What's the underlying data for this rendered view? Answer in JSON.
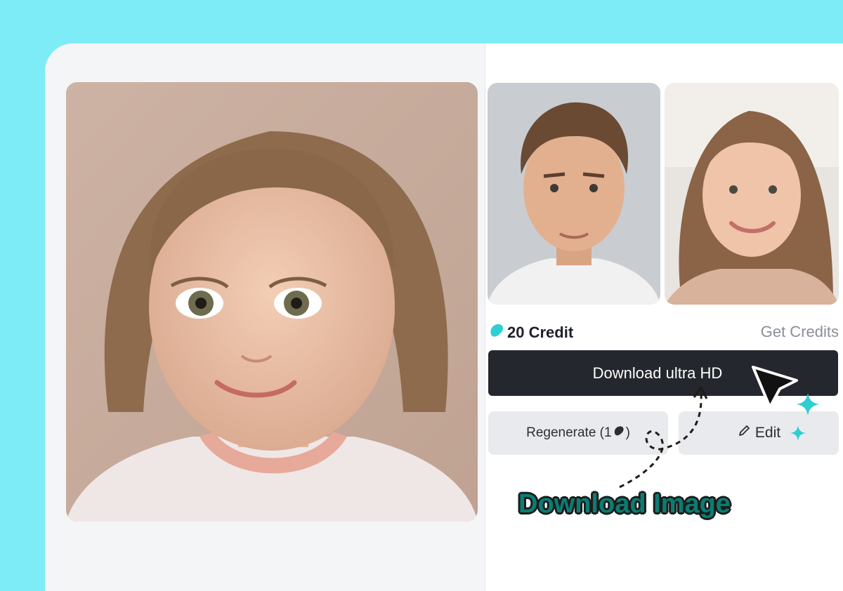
{
  "credits": {
    "amount": "20 Credit",
    "get_label": "Get Credits"
  },
  "actions": {
    "download_label": "Download ultra HD",
    "regenerate_label": "Regenerate (1",
    "regenerate_close": ")",
    "edit_label": "Edit"
  },
  "annotation": {
    "text": "Download Image"
  },
  "icons": {
    "credit": "bean-icon",
    "regen_cost": "bean-icon",
    "edit": "pencil-icon",
    "cursor": "cursor-arrow-icon",
    "sparkle": "sparkle-icon"
  },
  "colors": {
    "background": "#7eecf6",
    "accent": "#2ccfd3",
    "button_dark": "#24272d",
    "button_light": "#e9eaed",
    "label_fill": "#0b7d73"
  }
}
